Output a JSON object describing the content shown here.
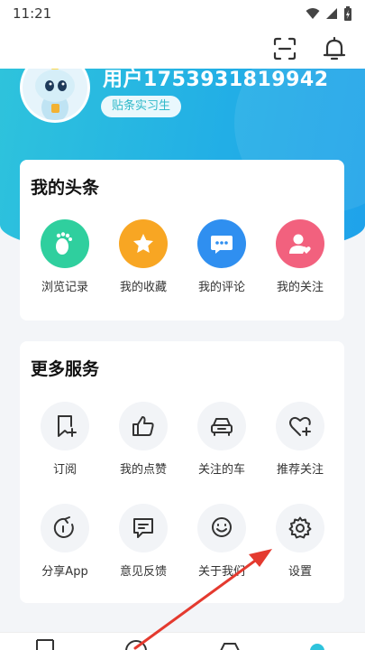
{
  "status_bar": {
    "time": "11:21"
  },
  "profile": {
    "username": "用户1753931819942",
    "badge": "贴条实习生"
  },
  "my_toutiao": {
    "title": "我的头条",
    "items": [
      {
        "label": "浏览记录",
        "icon": "footprint-icon",
        "color": "#2fcf9e"
      },
      {
        "label": "我的收藏",
        "icon": "star-icon",
        "color": "#f8a623"
      },
      {
        "label": "我的评论",
        "icon": "comment-icon",
        "color": "#2f8ff0"
      },
      {
        "label": "我的关注",
        "icon": "user-heart-icon",
        "color": "#f2617e"
      }
    ]
  },
  "more_services": {
    "title": "更多服务",
    "items": [
      {
        "label": "订阅",
        "icon": "bookmark-add-icon"
      },
      {
        "label": "我的点赞",
        "icon": "thumb-up-icon"
      },
      {
        "label": "关注的车",
        "icon": "car-icon"
      },
      {
        "label": "推荐关注",
        "icon": "heart-add-icon"
      },
      {
        "label": "分享App",
        "icon": "share-icon"
      },
      {
        "label": "意见反馈",
        "icon": "feedback-icon"
      },
      {
        "label": "关于我们",
        "icon": "smile-icon"
      },
      {
        "label": "设置",
        "icon": "gear-icon"
      }
    ]
  }
}
